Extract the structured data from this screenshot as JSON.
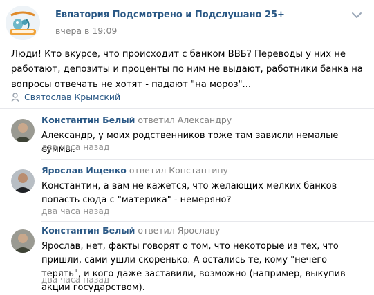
{
  "post": {
    "group_name": "Евпатория Подсмотрено и Подслушано 25+",
    "time": "вчера в 19:09",
    "logo_icon": "evpatoria-group-logo",
    "text": "Люди! Кто вкурсе, что происходит с банком ВВБ? Переводы у них не работают, депозиты и проценты по ним не выдают, работники банка на вопросы отвечать не хотят - падают \"на мороз\"...",
    "signer": "Святослав Крымский",
    "more_icon": "chevron-down-icon"
  },
  "comments": [
    {
      "author": "Константин Белый",
      "reply_to": "ответил Александру",
      "text": "Александр, у моих родственников тоже там зависли немалые суммы.",
      "time": "два часа назад"
    },
    {
      "author": "Ярослав Ищенко",
      "reply_to": "ответил Константину",
      "text": "Константин, а вам не кажется, что желающих мелких банков попасть сюда с \"материка\" - немеряно?",
      "time": "два часа назад"
    },
    {
      "author": "Константин Белый",
      "reply_to": "ответил Ярославу",
      "text": "Ярослав, нет, факты говорят о том, что некоторые из тех, что пришли, сами ушли скоренько. А остались те, кому \"нечего терять\", и кого даже заставили, возможно (например, выкупив акции государством).",
      "time": "два часа назад"
    }
  ],
  "colors": {
    "link": "#2a5885",
    "meta": "#828282",
    "divider": "#e7e8ec"
  }
}
